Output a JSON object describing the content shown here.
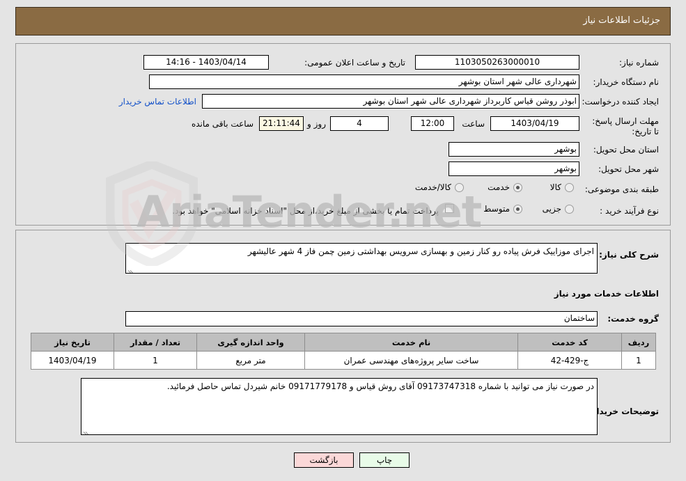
{
  "header": {
    "title": "جزئیات اطلاعات نیاز",
    "bar_color": "#8a6b43"
  },
  "watermark": {
    "text": "AriaTender.net"
  },
  "summary": {
    "need_number": {
      "label": "شماره نیاز:",
      "value": "1103050263000010"
    },
    "announce_datetime": {
      "label": "تاریخ و ساعت اعلان عمومی:",
      "value": "1403/04/14 - 14:16"
    },
    "buyer_org": {
      "label": "نام دستگاه خریدار:",
      "value": "شهرداری عالی شهر استان بوشهر"
    },
    "request_creator": {
      "label": "ایجاد کننده درخواست:",
      "value": "ابوذر روشن قیاس کاربرداز شهرداری عالی شهر استان بوشهر"
    },
    "contact_link": "اطلاعات تماس خریدار",
    "deadline": {
      "label": "مهلت ارسال پاسخ: تا تاریخ:",
      "date": "1403/04/19",
      "hour_label": "ساعت",
      "hour": "12:00",
      "days": "4",
      "days_label": "روز و",
      "countdown": "21:11:44",
      "countdown_label": "ساعت باقی مانده"
    },
    "delivery_province": {
      "label": "استان محل تحویل:",
      "value": "بوشهر"
    },
    "delivery_city": {
      "label": "شهر محل تحویل:",
      "value": "بوشهر"
    },
    "category": {
      "label": "طبقه بندی موضوعی:",
      "options": [
        "کالا",
        "خدمت",
        "کالا/خدمت"
      ],
      "selected": "خدمت"
    },
    "purchase_type": {
      "label": "نوع فرآیند خرید :",
      "options": [
        "جزیی",
        "متوسط"
      ],
      "selected": "متوسط",
      "treasury_note": "پرداخت تمام یا بخشی از مبلغ خرید،از محل \"اسناد خزانه اسلامی\" خواهد بود.",
      "treasury_checked": false
    }
  },
  "need_description": {
    "label": "شرح کلی نیاز:",
    "value": "اجرای موزاییک فرش پیاده رو کنار زمین و بهسازی سرویس بهداشتی زمین چمن فاز 4 شهر عالیشهر"
  },
  "services_section": {
    "heading": "اطلاعات خدمات مورد نیاز",
    "service_group": {
      "label": "گروه خدمت:",
      "value": "ساختمان"
    },
    "table": {
      "columns": [
        "ردیف",
        "کد خدمت",
        "نام خدمت",
        "واحد اندازه گیری",
        "تعداد / مقدار",
        "تاریخ نیاز"
      ],
      "rows": [
        [
          "1",
          "ج-429-42",
          "ساخت سایر پروژه‌های مهندسی عمران",
          "متر مربع",
          "1",
          "1403/04/19"
        ]
      ]
    }
  },
  "buyer_notes": {
    "label": "توضیحات خریدار:",
    "value": "در صورت نیاز می توانید با شماره 09173747318 آقای روش قیاس و 09171779178 خانم شیردل تماس حاصل فرمائید."
  },
  "footer": {
    "print_label": "چاپ",
    "back_label": "بازگشت",
    "print_color": "#e8fbe8",
    "back_color": "#fbd8d8"
  }
}
